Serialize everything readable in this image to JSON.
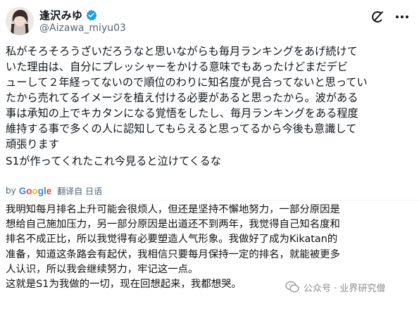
{
  "user": {
    "display_name": "逢沢みゆ",
    "handle": "@Aizawa_miyu03"
  },
  "icons": [
    "verified-badge-icon",
    "grok-icon",
    "more-options-icon",
    "wechat-watermark-icon"
  ],
  "colors": {
    "verified": "#1d9bf0",
    "text": "#0f1419",
    "muted": "#536471"
  },
  "tweet": {
    "lines": [
      "私がそろそろうざいだろうなと思いながらも毎月ランキングをあげ続けて",
      "いた理由は、自分にプレッシャーをかける意味でもあったけどまだデビ",
      "ューして２年経ってないので順位のわりに知名度が見合ってないと思ってい",
      "たから売れてるイメージを植え付ける必要があると思ったから。波がある",
      "事は承知の上でキカタンになる覚悟をしたし、毎月ランキングをある程度",
      "維持する事で多くの人に認知してもらえると思ってるから今後も意識して",
      "頑張ります",
      "S1が作ってくれたこれ今見ると泣けてくるな"
    ]
  },
  "translate": {
    "by": "by",
    "google": [
      "G",
      "o",
      "o",
      "g",
      "l",
      "e"
    ],
    "label": "翻译自 日语"
  },
  "translation": {
    "lines": [
      "我明知每月排名上升可能会很烦人，但还是坚持不懈地努力，一部分原因是",
      "想给自己施加压力，另一部分原因是出道还不到两年，我觉得自己知名度和",
      "排名不成正比，所以我觉得有必要塑造人气形象。我做好了成为Kikatan的",
      "准备，知道这条路会有起伏，我相信只要每月保持一定的排名，就能被更多",
      "人认识，所以我会继续努力，牢记这一点。",
      "这就是S1为我做的一切，现在回想起来，我都想哭。"
    ]
  },
  "watermark": {
    "text": "公众号 · 业界研究僧"
  }
}
